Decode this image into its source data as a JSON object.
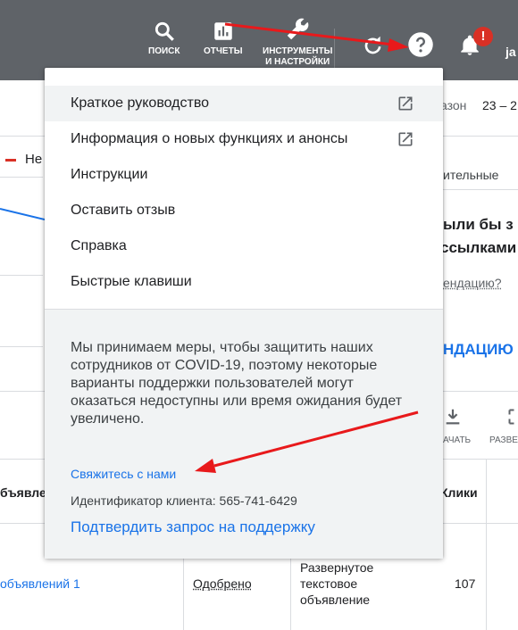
{
  "topbar": {
    "search_label": "ПОИСК",
    "reports_label": "ОТЧЕТЫ",
    "tools_label_line1": "ИНСТРУМЕНТЫ",
    "tools_label_line2": "И НАСТРОЙКИ",
    "notification_badge": "!",
    "user_partial": "ja"
  },
  "background": {
    "period_label": "азон",
    "period_value": "23 – 2",
    "legend_partial": "Не",
    "rec_header_partial": "ительные",
    "rec_title_line1": "ыли бы з",
    "rec_title_line2": "ссылками",
    "rec_question": "ендацию?",
    "rec_action": "НДАЦИЮ",
    "download_label": "АЧАТЬ",
    "expand_label": "РАЗВЕ",
    "col_ads": "бъявле",
    "col_clicks": "Клики",
    "row_ad_group": "объявлений 1",
    "row_status": "Одобрено",
    "row_type_line1": "Развернутое",
    "row_type_line2": "текстовое",
    "row_type_line3": "объявление",
    "row_clicks": "107"
  },
  "help_menu": {
    "items": [
      {
        "label": "Краткое руководство",
        "external": true
      },
      {
        "label": "Информация о новых функциях и анонсы",
        "external": true
      },
      {
        "label": "Инструкции",
        "external": false
      },
      {
        "label": "Оставить отзыв",
        "external": false
      },
      {
        "label": "Справка",
        "external": false
      },
      {
        "label": "Быстрые клавиши",
        "external": false
      }
    ],
    "notice": "Мы принимаем меры, чтобы защитить наших сотрудников от COVID-19, поэтому некоторые варианты поддержки пользователей могут оказаться недоступны или время ожидания будет увеличено.",
    "contact_link": "Свяжитесь с нами",
    "client_id": "Идентификатор клиента: 565-741-6429",
    "confirm_link": "Подтвердить запрос на поддержку"
  },
  "colors": {
    "topbar": "#5f6368",
    "link": "#1a73e8",
    "annotation": "#e8191b"
  }
}
